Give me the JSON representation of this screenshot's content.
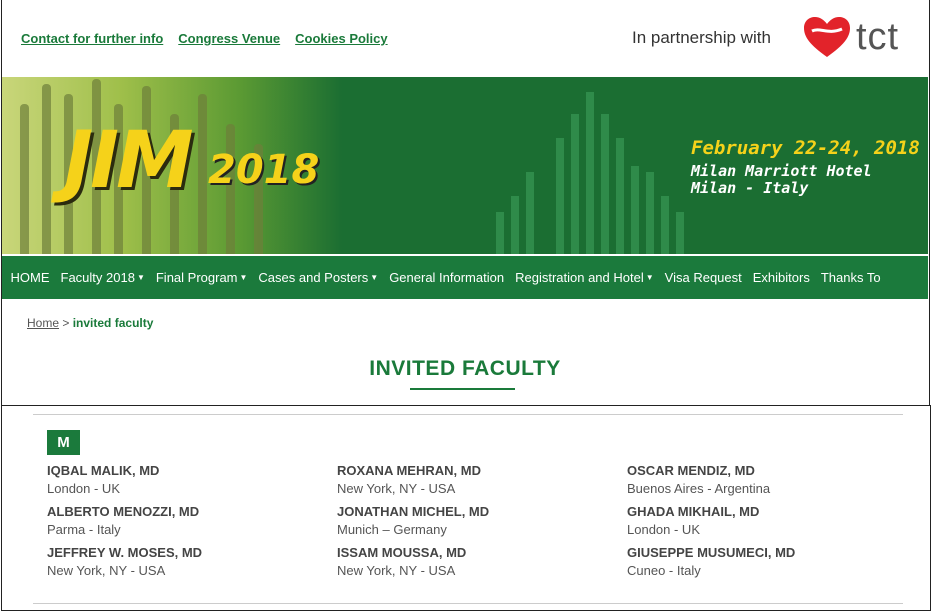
{
  "top_links": [
    "Contact for further info",
    "Congress Venue",
    "Cookies Policy"
  ],
  "partner_text": "In partnership with",
  "partner_logo": "tct",
  "banner": {
    "logo_jim": "JIM",
    "logo_year": "2018",
    "date": "February 22-24, 2018",
    "venue_line1": "Milan Marriott Hotel",
    "venue_line2": "Milan - Italy"
  },
  "nav": [
    {
      "label": "HOME",
      "dropdown": false
    },
    {
      "label": "Faculty 2018",
      "dropdown": true
    },
    {
      "label": "Final Program",
      "dropdown": true
    },
    {
      "label": "Cases and Posters",
      "dropdown": true
    },
    {
      "label": "General Information",
      "dropdown": false
    },
    {
      "label": "Registration and Hotel",
      "dropdown": true
    },
    {
      "label": "Visa Request",
      "dropdown": false
    },
    {
      "label": "Exhibitors",
      "dropdown": false
    },
    {
      "label": "Thanks To",
      "dropdown": false
    }
  ],
  "breadcrumb": {
    "home": "Home",
    "separator": ">",
    "current": "invited faculty"
  },
  "page_title": "INVITED FACULTY",
  "letter": "M",
  "faculty": [
    {
      "name": "IQBAL MALIK, MD",
      "location": "London - UK"
    },
    {
      "name": "ROXANA MEHRAN, MD",
      "location": "New York, NY - USA"
    },
    {
      "name": "OSCAR MENDIZ, MD",
      "location": "Buenos Aires - Argentina"
    },
    {
      "name": "ALBERTO MENOZZI, MD",
      "location": "Parma - Italy"
    },
    {
      "name": "JONATHAN MICHEL, MD",
      "location": "Munich – Germany"
    },
    {
      "name": "GHADA MIKHAIL, MD",
      "location": "London - UK"
    },
    {
      "name": "JEFFREY W. MOSES, MD",
      "location": "New York, NY - USA"
    },
    {
      "name": "ISSAM MOUSSA, MD",
      "location": "New York, NY - USA"
    },
    {
      "name": "GIUSEPPE MUSUMECI, MD",
      "location": "Cuneo - Italy"
    }
  ],
  "colors": {
    "brand_green": "#1b7a3c",
    "link_green": "#1a7a3a",
    "banner_yellow": "#f5d21a",
    "logo_red": "#e2232a"
  }
}
